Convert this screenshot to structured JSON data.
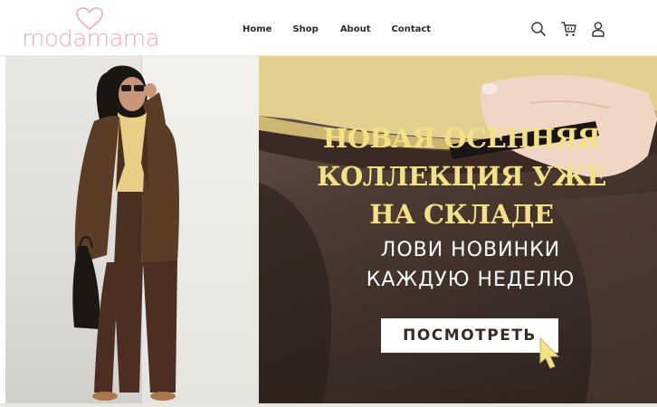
{
  "brand": {
    "logo_text": "modamama",
    "accent": "#f4a7b4"
  },
  "nav": [
    {
      "label": "Home"
    },
    {
      "label": "Shop"
    },
    {
      "label": "About"
    },
    {
      "label": "Contact"
    }
  ],
  "header_icons": [
    "search-icon",
    "cart-icon",
    "user-icon"
  ],
  "hero": {
    "headline_lines": [
      "НОВАЯ ОСЕННЯЯ",
      "КОЛЛЕКЦИЯ УЖЕ",
      "НА СКЛАДЕ"
    ],
    "subline_lines": [
      "ЛОВИ НОВИНКИ",
      "КАЖДУЮ НЕДЕЛЮ"
    ],
    "cta_label": "ПОСМОТРЕТЬ",
    "headline_color": "#f3e186",
    "text_color": "#ffffff"
  }
}
